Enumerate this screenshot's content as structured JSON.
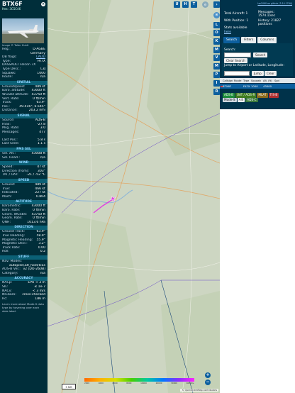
{
  "aircraft": {
    "callsign": "BTX6F",
    "hex_line": "Hex: 3C5C46",
    "image_credit": "Image © Taller Zuidt",
    "details": [
      {
        "k": "Reg.:",
        "v": "D-AGBE"
      },
      {
        "k": "",
        "v": "Germany"
      },
      {
        "k": "DB flags:",
        "v": "LADD"
      },
      {
        "k": "Type:",
        "v": "FA7X"
      },
      {
        "k": "DASSAULT Falcon 7X",
        "v": ""
      },
      {
        "k": "Type Desc.:",
        "v": "L3J"
      },
      {
        "k": "Squawk:",
        "v": "1000"
      },
      {
        "k": "Route:",
        "v": "n/a"
      }
    ]
  },
  "sections": [
    {
      "title": "SPATIAL",
      "rows": [
        {
          "k": "Groundspeed:",
          "v": "489 kt"
        },
        {
          "k": "Baro. altitude:",
          "v": "43000 ft"
        },
        {
          "k": "WGS84 altitude:",
          "v": "43750 ft"
        },
        {
          "k": "Vert. Rate:",
          "v": "0 ft/min"
        },
        {
          "k": "Track:",
          "v": "63.9°"
        },
        {
          "k": "Pos.:",
          "v": "49.416°, 6.545°"
        },
        {
          "k": "Distance:",
          "v": "203.2 nmi"
        }
      ]
    },
    {
      "title": "SIGNAL",
      "rows": [
        {
          "k": "Source:",
          "v": "ADS-B"
        },
        {
          "k": "RSSI:",
          "v": "-27.8"
        },
        {
          "k": "Msg. Rate:",
          "v": "3.0"
        },
        {
          "k": "Messages:",
          "v": "477"
        },
        {
          "k": "",
          "v": ""
        },
        {
          "k": "Last Pos.:",
          "v": "5.8 s"
        },
        {
          "k": "Last Seen:",
          "v": "1.1 s"
        }
      ]
    },
    {
      "title": "FMS SEL",
      "rows": [
        {
          "k": "Sel. Alt.:",
          "v": "43008 ft"
        },
        {
          "k": "Sel. Head.:",
          "v": "n/a"
        }
      ]
    },
    {
      "title": "WIND",
      "rows": [
        {
          "k": "Speed:",
          "v": "47 kt"
        },
        {
          "k": "Direction (from):",
          "v": "303°"
        },
        {
          "k": "TAT / OAT:",
          "v": "-21 / -52 °C"
        }
      ]
    },
    {
      "title": "SPEED",
      "rows": [
        {
          "k": "Ground:",
          "v": "489 kt"
        },
        {
          "k": "True:",
          "v": "466 kt"
        },
        {
          "k": "Indicated:",
          "v": "227 kt"
        },
        {
          "k": "Mach:",
          "v": "0.804"
        }
      ]
    },
    {
      "title": "ALTITUDE",
      "rows": [
        {
          "k": "Barometric:",
          "v": "43000 ft"
        },
        {
          "k": "Baro. Rate:",
          "v": "0 ft/min"
        },
        {
          "k": "Geom. WGS84:",
          "v": "43750 ft"
        },
        {
          "k": "Geom. Rate:",
          "v": "0 ft/min"
        },
        {
          "k": "QNH:",
          "v": "1013.6 hPa"
        }
      ]
    },
    {
      "title": "DIRECTION",
      "rows": [
        {
          "k": "Ground Track:",
          "v": "63.9°"
        },
        {
          "k": "True Heading:",
          "v": "58.9°"
        },
        {
          "k": "Magnetic Heading:",
          "v": "55.9°"
        },
        {
          "k": "Magnetic Decl.:",
          "v": "3.2°"
        },
        {
          "k": "Track Rate:",
          "v": "0.00"
        },
        {
          "k": "Roll:",
          "v": "0.2"
        }
      ]
    },
    {
      "title": "STUFF",
      "rows": [
        {
          "k": "Nav. Modes:",
          "v": ""
        },
        {
          "k": "",
          "v": "autopilot,alt_hold,tcas"
        },
        {
          "k": "ADS-B Ver.:",
          "v": "v2 (DO-260B)"
        },
        {
          "k": "Category:",
          "v": "n/a"
        }
      ]
    },
    {
      "title": "ACCURACY",
      "rows": [
        {
          "k": "NACp:",
          "v": "EPU < 3 m"
        },
        {
          "k": "SIL:",
          "v": "≤ 1e-7"
        },
        {
          "k": "NACv:",
          "v": "< 3 m/s"
        },
        {
          "k": "NICbaro:",
          "v": "cross-checked"
        },
        {
          "k": "Rc:",
          "v": "186 m"
        }
      ]
    }
  ],
  "footer_note": "Learn more about Mode-S data type by hovering over each data label.",
  "map": {
    "scale_label": "5 NM",
    "color_scale_labels": [
      "2000",
      "4000",
      "6000",
      "8000",
      "10000",
      "20000",
      "30000",
      "40000+"
    ],
    "osm_credit": "© OpenStreetMap contributors",
    "layer_buttons": [
      "U",
      "H",
      "T"
    ],
    "toolbar": [
      "L",
      "O",
      "K",
      "M",
      "V",
      "M",
      "P",
      "I",
      "R"
    ],
    "zoom_in": "+",
    "zoom_out": "−"
  },
  "stats": {
    "github": "tar1090 on github (3.14.1764)",
    "total_aircraft": "Total Aircraft: 1",
    "with_position": "With Position: 1",
    "stats_available": "Stats available",
    "here": "here",
    "messages": "Messages: 1574.1/sec",
    "history": "History: 21827 positions"
  },
  "tabs": [
    "Search",
    "Filters",
    "Columns"
  ],
  "search": {
    "label": "Search:",
    "button": "Search",
    "clear": "Clear Search",
    "jump_label": "Jump to Airport or Latitude, Longitude:",
    "jump_button": "Jump",
    "clear_button": "Clear"
  },
  "table": {
    "headers": [
      "Callsign",
      "Route",
      "Type",
      "Squawk",
      "Alt. (ft)",
      "Spd"
    ],
    "rows": [
      [
        "BTX6F",
        "",
        "FA7X",
        "1000",
        "43000",
        ""
      ]
    ]
  },
  "legend": {
    "chips": [
      "ADS-B",
      "UAT / ADS-R",
      "MLAT",
      "TIS-B",
      "Mode-S",
      "AIS",
      "ADS-C"
    ],
    "colors": [
      "#1d8c3a",
      "#3f7c1f",
      "#8c6c1d",
      "#b03030",
      "#cfd8e0",
      "#ffffff",
      "#3d7a3d"
    ]
  },
  "theme": {
    "sidebar": "#002e3a",
    "accent": "#0c5f9e",
    "section": "#0b6075"
  }
}
